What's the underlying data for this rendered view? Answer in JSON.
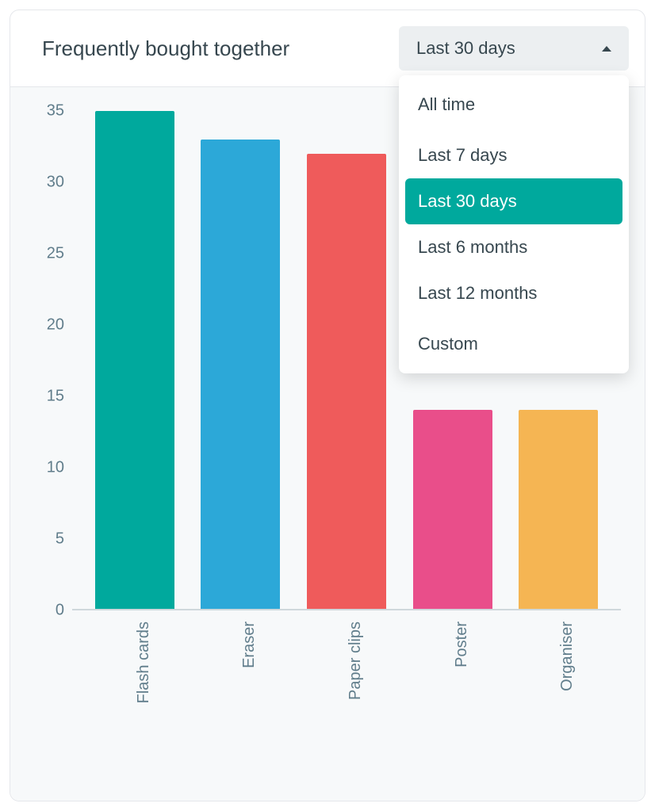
{
  "header": {
    "title": "Frequently bought together"
  },
  "dropdown": {
    "selected_label": "Last 30 days",
    "options": [
      {
        "label": "All time",
        "selected": false,
        "group": 0
      },
      {
        "label": "Last 7 days",
        "selected": false,
        "group": 1
      },
      {
        "label": "Last 30 days",
        "selected": true,
        "group": 1
      },
      {
        "label": "Last 6 months",
        "selected": false,
        "group": 1
      },
      {
        "label": "Last 12 months",
        "selected": false,
        "group": 1
      },
      {
        "label": "Custom",
        "selected": false,
        "group": 2
      }
    ]
  },
  "chart_data": {
    "type": "bar",
    "categories": [
      "Flash cards",
      "Eraser",
      "Paper clips",
      "Poster",
      "Organiser"
    ],
    "values": [
      35,
      33,
      32,
      14,
      14
    ],
    "colors": [
      "#00a99d",
      "#2ca8d8",
      "#ef5b5b",
      "#e94e8a",
      "#f5b553"
    ],
    "ylim": [
      0,
      35
    ],
    "yticks": [
      0,
      5,
      10,
      15,
      20,
      25,
      30,
      35
    ],
    "title": "",
    "xlabel": "",
    "ylabel": ""
  }
}
